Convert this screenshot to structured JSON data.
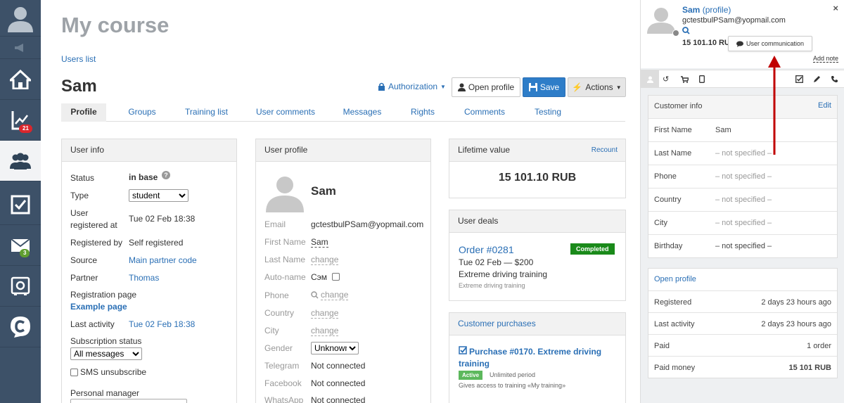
{
  "sidebar": {
    "badges": {
      "stats": "21",
      "mail": "3"
    }
  },
  "page": {
    "title": "My course",
    "breadcrumb": "Users list",
    "user_name": "Sam"
  },
  "toolbar": {
    "authorization": "Authorization",
    "open_profile": "Open profile",
    "save": "Save",
    "actions": "Actions"
  },
  "tabs": [
    "Profile",
    "Groups",
    "Training list",
    "User comments",
    "Messages",
    "Rights",
    "Comments",
    "Testing"
  ],
  "user_info": {
    "header": "User info",
    "status_label": "Status",
    "status_value": "in base",
    "type_label": "Type",
    "type_value": "student",
    "registered_label_1": "User",
    "registered_label_2": "registered at",
    "registered_value": "Tue 02 Feb 18:38",
    "registered_by_label": "Registered by",
    "registered_by_value": "Self registered",
    "source_label": "Source",
    "source_value": "Main partner code",
    "partner_label": "Partner",
    "partner_value": "Thomas",
    "reg_page_label": "Registration page",
    "reg_page_value": "Example page",
    "last_activity_label": "Last activity",
    "last_activity_value": "Tue 02 Feb 18:38",
    "subscription_label": "Subscription status",
    "subscription_value": "All messages",
    "sms_label": "SMS unsubscribe",
    "manager_label": "Personal manager"
  },
  "user_profile": {
    "header": "User profile",
    "name": "Sam",
    "email_label": "Email",
    "email_value": "gctestbulPSam@yopmail.com",
    "first_name_label": "First Name",
    "first_name_value": "Sam",
    "last_name_label": "Last Name",
    "change": "change",
    "autoname_label": "Auto-name",
    "autoname_value": "Сэм",
    "phone_label": "Phone",
    "country_label": "Country",
    "city_label": "City",
    "gender_label": "Gender",
    "gender_value": "Unknown",
    "telegram_label": "Telegram",
    "telegram_value": "Not connected",
    "facebook_label": "Facebook",
    "facebook_value": "Not connected",
    "whatsapp_label": "WhatsApp",
    "whatsapp_value": "Not connected"
  },
  "lifetime": {
    "header": "Lifetime value",
    "recount": "Recount",
    "value": "15 101.10 RUB"
  },
  "deals": {
    "header": "User deals",
    "order": "Order #0281",
    "status": "Completed",
    "status_color": "#1a8a1a",
    "date_price": "Tue 02 Feb — $200",
    "product": "Extreme driving training",
    "product_sub": "Extreme driving training"
  },
  "purchases": {
    "header": "Customer purchases",
    "title": "Purchase #0170. Extreme driving training",
    "status": "Active",
    "status_color": "#5cb85c",
    "period": "Unlimited period",
    "access": "Gives access to training «My training»"
  },
  "right": {
    "name": "Sam",
    "profile_link": "(profile)",
    "email": "gctestbulPSam@yopmail.com",
    "amount": "15 101.10 RUB",
    "user_comm": "User communication",
    "add_note": "Add note",
    "customer_info": {
      "header": "Customer info",
      "edit": "Edit",
      "rows": [
        {
          "k": "First Name",
          "v": "Sam"
        },
        {
          "k": "Last Name",
          "v": "– not specified –"
        },
        {
          "k": "Phone",
          "v": "– not specified –"
        },
        {
          "k": "Country",
          "v": "– not specified –"
        },
        {
          "k": "City",
          "v": "– not specified –"
        },
        {
          "k": "Birthday",
          "v": "– not specified –"
        }
      ]
    },
    "stats": {
      "open_profile": "Open profile",
      "rows": [
        {
          "k": "Registered",
          "v": "2 days 23 hours ago"
        },
        {
          "k": "Last activity",
          "v": "2 days 23 hours ago"
        },
        {
          "k": "Paid",
          "v": "1 order"
        },
        {
          "k": "Paid money",
          "v": "15 101 RUB"
        }
      ]
    }
  },
  "colors": {
    "sidebar": "#3d5168",
    "accent": "#2a6fb5",
    "save": "#2e7dc8",
    "red_badge": "#d9262c",
    "green_badge": "#5f9e2f",
    "arrow": "#c00000"
  }
}
